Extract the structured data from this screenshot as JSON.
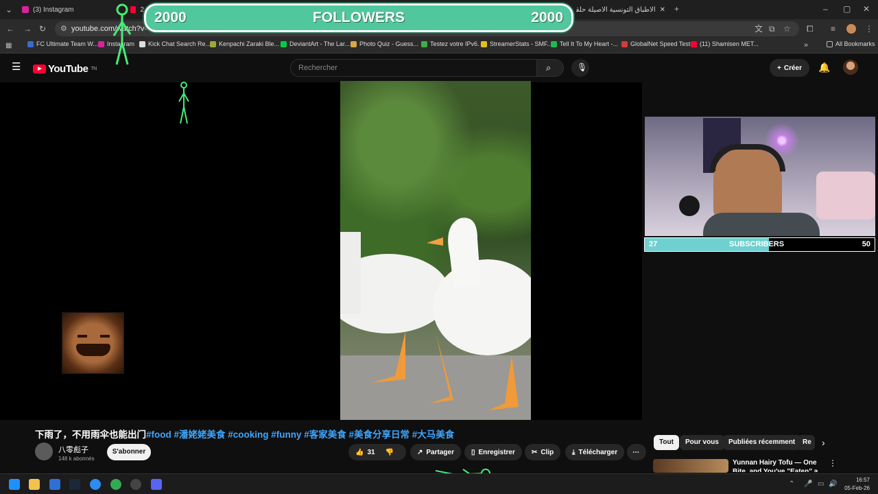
{
  "browser": {
    "tabs": [
      {
        "label": "(3) Instagram"
      },
      {
        "label": "2"
      },
      {
        "label": "الاطباق التونسية الاصيلة حلقة اـ"
      }
    ],
    "url": "youtube.com/watch?v=kdr",
    "bookmarks": [
      {
        "label": "FC Ultimate Team W...",
        "color": "#3a6bd1"
      },
      {
        "label": "Instagram",
        "color": "#d6249f"
      },
      {
        "label": "Kick Chat Search Re...",
        "color": "#dddddd"
      },
      {
        "label": "Kenpachi Zaraki Ble...",
        "color": "#9fa63c"
      },
      {
        "label": "DeviantArt - The Lar...",
        "color": "#05cc47"
      },
      {
        "label": "Photo Quiz - Guess...",
        "color": "#d9a54b"
      },
      {
        "label": "Testez votre IPv6.",
        "color": "#3fae49"
      },
      {
        "label": "StreamerStats - SMF...",
        "color": "#e0c020"
      },
      {
        "label": "Tell It To My Heart -...",
        "color": "#1db954"
      },
      {
        "label": "GlobalNet Speed Test",
        "color": "#d23b3b"
      },
      {
        "label": "(11) Shamisen MET...",
        "color": "#ff0033"
      }
    ],
    "all_bookmarks": "All Bookmarks"
  },
  "overlay": {
    "followers_left": "2000",
    "followers_label": "FOLLOWERS",
    "followers_right": "2000",
    "subs_current": "27",
    "subs_label": "SUBSCRIBERS",
    "subs_goal": "50",
    "subs_progress": 0.54
  },
  "youtube": {
    "logo": "YouTube",
    "logo_region": "TN",
    "search_placeholder": "Rechercher",
    "create_label": "Créer",
    "video_title_main": "下雨了，不用雨伞也能出门",
    "video_title_tags": "#food #潘姥姥美食 #cooking #funny #客家美食 #美食分享日常 #大马美食",
    "channel_name": "八零彪子",
    "channel_subs": "148 k abonnés",
    "subscribe_label": "S'abonner",
    "likes": "31",
    "share_label": "Partager",
    "save_label": "Enregistrer",
    "clip_label": "Clip",
    "download_label": "Télécharger",
    "chips": [
      "Tout",
      "Pour vous",
      "Publiées récemment",
      "Re"
    ],
    "rec_title": "Yunnan Hairy Tofu — One Bite, and You've \"Eaten\" a Snow..."
  },
  "taskbar": {
    "time": "16:57",
    "date": "05-Feb-26"
  },
  "colors": {
    "accent_green": "#51c79e",
    "subs_fill": "#6fd0cf",
    "youtube_red": "#ff0033",
    "hashtag_blue": "#3ea6ff"
  }
}
